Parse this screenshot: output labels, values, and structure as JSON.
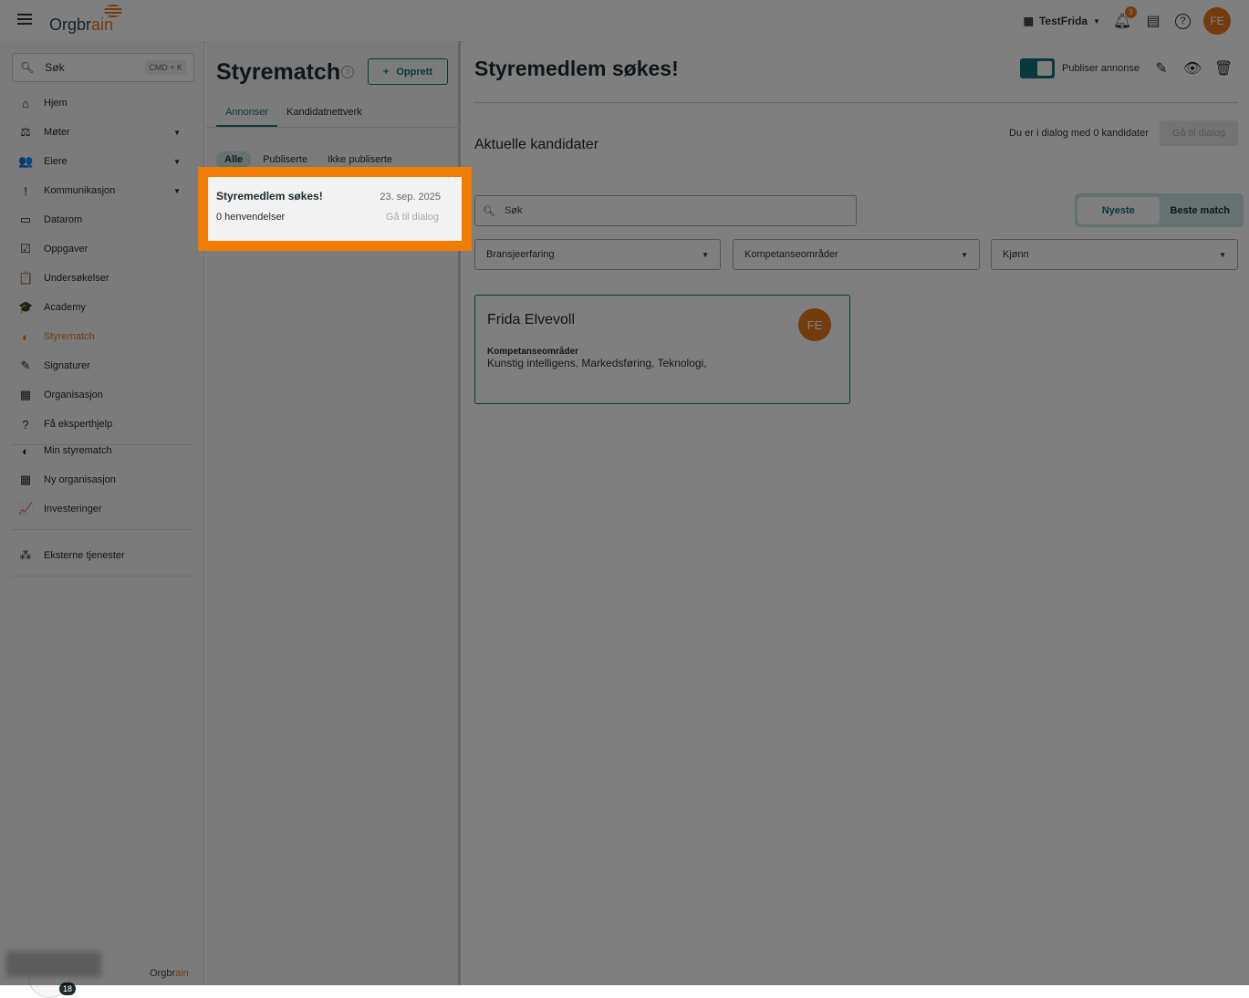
{
  "header": {
    "logo": "Orgbrain",
    "org": "TestFrida",
    "notifications": "3",
    "avatar": "FE"
  },
  "sidebar": {
    "search_placeholder": "Søk",
    "shortcut": "CMD + K",
    "items": [
      {
        "label": "Hjem",
        "icon": "⌂"
      },
      {
        "label": "Møter",
        "icon": "⚖",
        "caret": true
      },
      {
        "label": "Eiere",
        "icon": "👥",
        "caret": true
      },
      {
        "label": "Kommunikasjon",
        "icon": "!",
        "caret": true
      },
      {
        "label": "Datarom",
        "icon": "▭"
      },
      {
        "label": "Oppgaver",
        "icon": "☑"
      },
      {
        "label": "Undersøkelser",
        "icon": "📋"
      },
      {
        "label": "Academy",
        "icon": "🎓"
      },
      {
        "label": "Styrematch",
        "icon": "◐",
        "active": true
      },
      {
        "label": "Signaturer",
        "icon": "✎"
      },
      {
        "label": "Organisasjon",
        "icon": "▦"
      },
      {
        "label": "Få eksperthjelp",
        "icon": "?"
      }
    ],
    "items2": [
      {
        "label": "Min styrematch",
        "icon": "◐"
      },
      {
        "label": "Ny organisasjon",
        "icon": "▦"
      },
      {
        "label": "Investeringer",
        "icon": "📈"
      }
    ],
    "items3": [
      {
        "label": "Eksterne tjenester",
        "icon": "⁂"
      }
    ],
    "chat_badge": "18",
    "footer_logo": "Orgbrain"
  },
  "middle": {
    "title": "Styrematch",
    "create": "Opprett",
    "tabs": [
      "Annonser",
      "Kandidatnettverk"
    ],
    "filters": [
      "Alle",
      "Publiserte",
      "Ikke publiserte"
    ],
    "ad": {
      "title": "Styremedlem søkes!",
      "date": "23. sep. 2025",
      "responses": "0 henvendelser",
      "dialog": "Gå til dialog"
    }
  },
  "right": {
    "title": "Styremedlem søkes!",
    "publish": "Publiser annonse",
    "section": "Aktuelle kandidater",
    "dialog_text": "Du er i dialog med 0 kandidater",
    "dialog_button": "Gå til dialog",
    "search_placeholder": "Søk",
    "sort": [
      "Nyeste",
      "Beste match"
    ],
    "selects": [
      "Bransjeerfaring",
      "Kompetanseområder",
      "Kjønn"
    ],
    "candidate": {
      "name": "Frida Elvevoll",
      "avatar": "FE",
      "label": "Kompetanseområder",
      "value": "Kunstig intelligens, Markedsføring, Teknologi,"
    }
  }
}
